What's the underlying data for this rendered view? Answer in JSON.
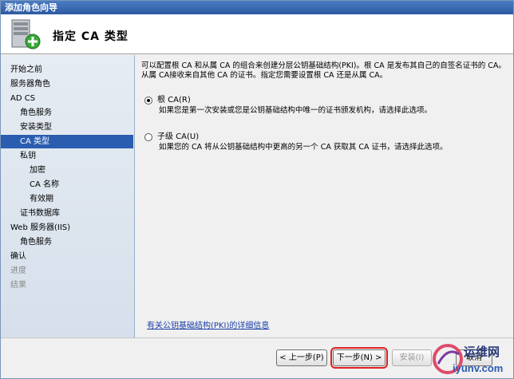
{
  "window": {
    "title": "添加角色向导"
  },
  "header": {
    "title": "指定 CA 类型"
  },
  "sidebar": {
    "items": [
      {
        "label": "开始之前"
      },
      {
        "label": "服务器角色"
      },
      {
        "label": "AD CS"
      },
      {
        "label": "角色服务"
      },
      {
        "label": "安装类型"
      },
      {
        "label": "CA 类型"
      },
      {
        "label": "私钥"
      },
      {
        "label": "加密"
      },
      {
        "label": "CA 名称"
      },
      {
        "label": "有效期"
      },
      {
        "label": "证书数据库"
      },
      {
        "label": "Web 服务器(IIS)"
      },
      {
        "label": "角色服务"
      },
      {
        "label": "确认"
      },
      {
        "label": "进度"
      },
      {
        "label": "结果"
      }
    ]
  },
  "main": {
    "intro": "可以配置根 CA 和从属 CA 的组合来创建分层公钥基础结构(PKI)。根 CA 是发布其自己的自签名证书的 CA。从属 CA接收来自其他 CA 的证书。指定您需要设置根 CA 还是从属 CA。",
    "options": [
      {
        "label": "根 CA(R)",
        "description": "如果您是第一次安装或您是公钥基础结构中唯一的证书颁发机构，请选择此选项。",
        "checked": true
      },
      {
        "label": "子级 CA(U)",
        "description": "如果您的 CA 将从公钥基础结构中更高的另一个 CA 获取其 CA 证书，请选择此选项。",
        "checked": false
      }
    ],
    "more_link": "有关公钥基础结构(PKI)的详细信息"
  },
  "footer": {
    "back": "< 上一步(P)",
    "next": "下一步(N) >",
    "install": "安装(I)",
    "cancel": "取消"
  },
  "watermark": {
    "brand": "运维网",
    "site": "iyunv.com"
  }
}
